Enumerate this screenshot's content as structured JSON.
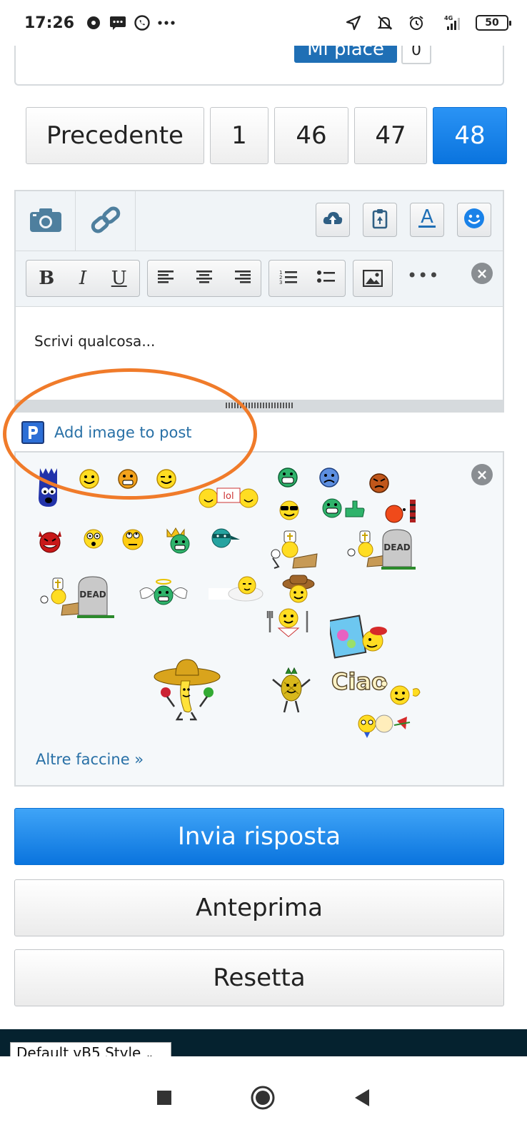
{
  "status_bar": {
    "time": "17:26",
    "network": "4G",
    "battery": "50"
  },
  "previous_post": {
    "like_label": "Mi piace",
    "like_count": "0"
  },
  "pagination": {
    "previous_label": "Precedente",
    "pages": [
      "1",
      "46",
      "47",
      "48"
    ],
    "current_page": "48"
  },
  "editor": {
    "placeholder": "Scrivi qualcosa...",
    "format_buttons": [
      "B",
      "I",
      "U"
    ],
    "more_label": "•••"
  },
  "add_image": {
    "label": "Add image to post"
  },
  "smilies": {
    "more_label": "Altre faccine »",
    "ciao_text": "Ciao",
    "dead_text": "DEAD",
    "lol_text": "lol"
  },
  "actions": {
    "submit_label": "Invia risposta",
    "preview_label": "Anteprima",
    "reset_label": "Resetta"
  },
  "footer": {
    "style_selected": "Default vB5 Style"
  },
  "colors": {
    "primary": "#0a74de",
    "link": "#2870a6",
    "annotation": "#f07b2a",
    "footer": "#05222f"
  }
}
